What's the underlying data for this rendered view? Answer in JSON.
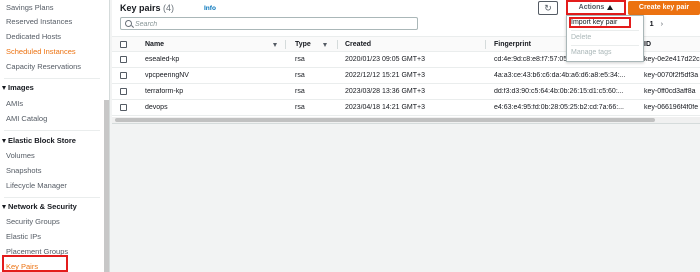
{
  "sidebar": {
    "items_top": [
      {
        "label": "Savings Plans",
        "active": false
      },
      {
        "label": "Reserved Instances",
        "active": false
      },
      {
        "label": "Dedicated Hosts",
        "active": false
      },
      {
        "label": "Scheduled Instances",
        "active": true
      },
      {
        "label": "Capacity Reservations",
        "active": false
      }
    ],
    "images": {
      "header": "Images",
      "items": [
        "AMIs",
        "AMI Catalog"
      ]
    },
    "ebs": {
      "header": "Elastic Block Store",
      "items": [
        "Volumes",
        "Snapshots",
        "Lifecycle Manager"
      ]
    },
    "network": {
      "header": "Network & Security",
      "items": [
        "Security Groups",
        "Elastic IPs",
        "Placement Groups",
        "Key Pairs"
      ]
    }
  },
  "header": {
    "title": "Key pairs",
    "count": "(4)",
    "info": "Info",
    "refresh_icon": "↻",
    "actions_label": "Actions",
    "create_label": "Create key pair"
  },
  "search": {
    "placeholder": "Search"
  },
  "pager": {
    "prev": "‹",
    "page": "1",
    "next": "›"
  },
  "table": {
    "columns": {
      "name": "Name",
      "type": "Type",
      "created": "Created",
      "fingerprint": "Fingerprint",
      "id": "ID"
    },
    "rows": [
      {
        "name": "esealed-kp",
        "type": "rsa",
        "created": "2020/01/23 09:05 GMT+3",
        "fingerprint": "cd:4e:9d:c8:e8:f7:57:05:4b:c0:b0:58:82:...",
        "id": "key-0e2e417d22c"
      },
      {
        "name": "vpcpeeringNV",
        "type": "rsa",
        "created": "2022/12/12 15:21 GMT+3",
        "fingerprint": "4a:a3:ce:43:b6:c6:da:4b:a6:d6:a8:e5:34:...",
        "id": "key-0070f2f5df3a"
      },
      {
        "name": "terraform-kp",
        "type": "rsa",
        "created": "2023/03/28 13:36 GMT+3",
        "fingerprint": "dd:f3:d3:90:c5:64:4b:0b:26:15:d1:c5:60:...",
        "id": "key-0ff0cd3aff8a"
      },
      {
        "name": "devops",
        "type": "rsa",
        "created": "2023/04/18 14:21 GMT+3",
        "fingerprint": "e4:63:e4:95:fd:0b:28:05:25:b2:cd:7a:66:...",
        "id": "key-066196f4f0fe"
      }
    ]
  },
  "actions_menu": {
    "items": [
      {
        "label": "Import key pair",
        "enabled": true
      },
      {
        "label": "Delete",
        "enabled": false
      },
      {
        "label": "Manage tags",
        "enabled": false
      }
    ]
  },
  "colors": {
    "accent": "#ec7211",
    "highlight_box": "#e31c1c",
    "link": "#0073bb"
  }
}
